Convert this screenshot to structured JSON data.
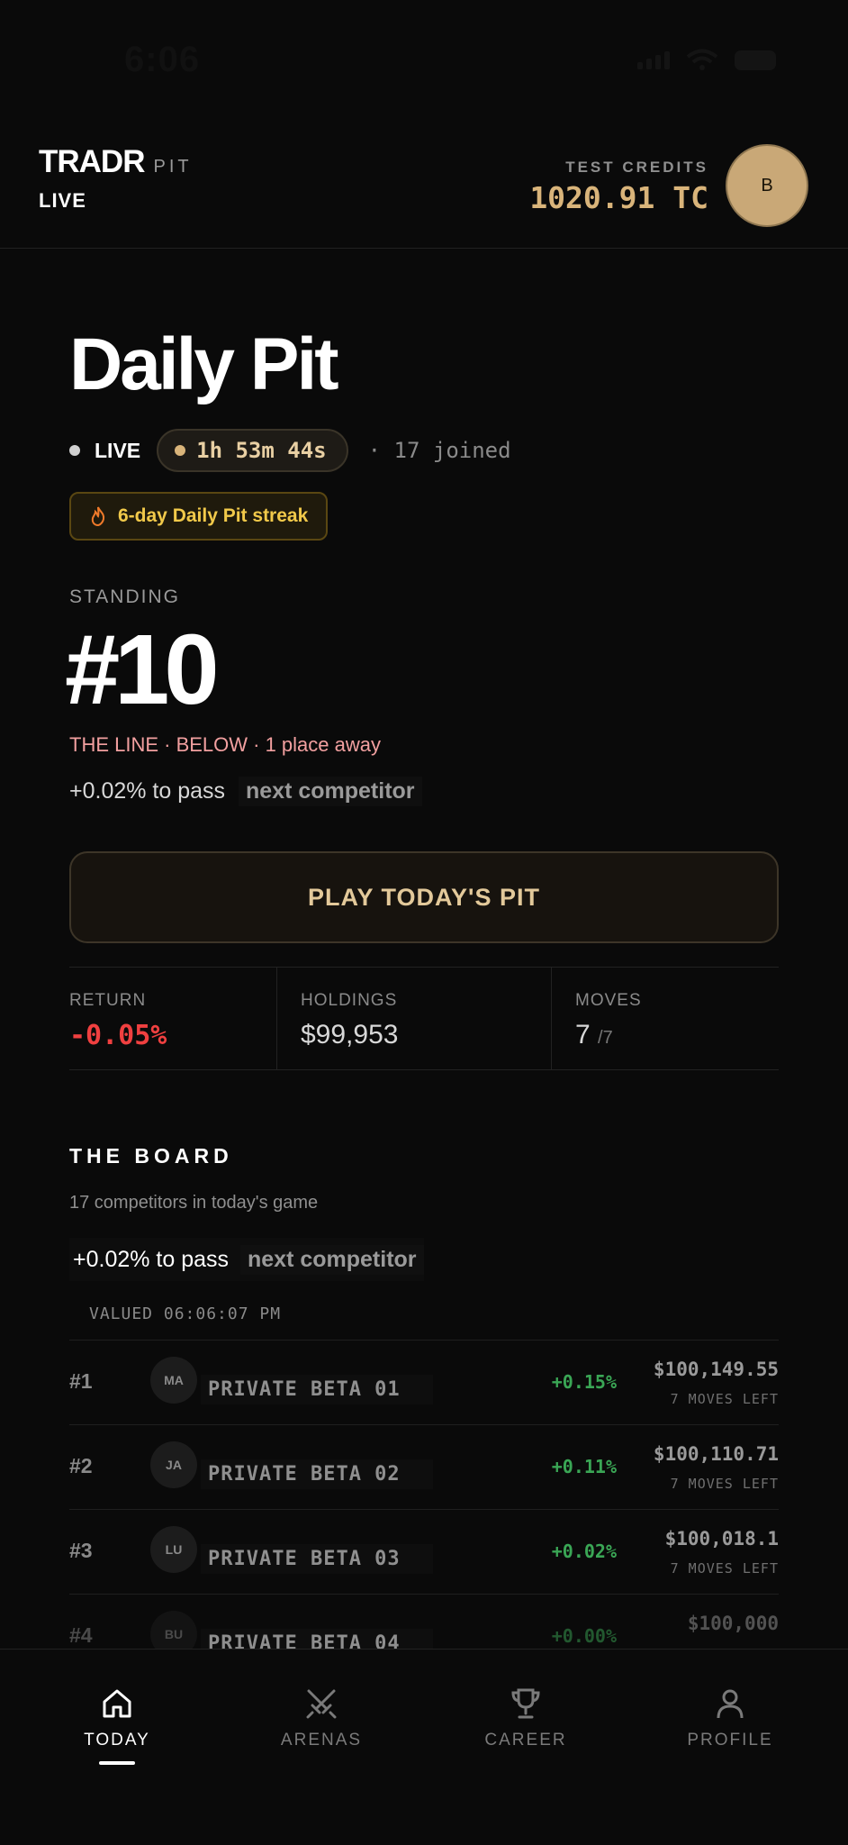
{
  "status_bar": {
    "time": "6:06"
  },
  "header": {
    "brand": "TRADR",
    "brand_sub": "PIT",
    "live": "LIVE",
    "credits_label": "TEST CREDITS",
    "credits_value": "1020.91 TC",
    "avatar_initial": "B"
  },
  "hero": {
    "title": "Daily Pit",
    "live_label": "LIVE",
    "timer": "1h 53m 44s",
    "joined": "· 17 joined",
    "streak": "6-day Daily Pit streak",
    "standing_label": "STANDING",
    "standing_value": "#10",
    "line_status": "THE LINE · BELOW · 1 place away",
    "pass_text": "+0.02% to pass",
    "pass_chip": "next competitor",
    "play_button": "PLAY TODAY'S PIT"
  },
  "stats": {
    "return_label": "RETURN",
    "return_value": "-0.05%",
    "holdings_label": "HOLDINGS",
    "holdings_value": "$99,953",
    "moves_label": "MOVES",
    "moves_value": "7",
    "moves_total": "/7"
  },
  "board": {
    "title": "THE BOARD",
    "subtitle": "17 competitors in today's game",
    "pass_text": "+0.02% to pass",
    "pass_chip": "next competitor",
    "valued": "VALUED 06:06:07 PM",
    "rows": [
      {
        "rank": "#1",
        "initials": "MA",
        "name": "PRIVATE BETA 01",
        "change": "+0.15%",
        "value": "$100,149.55",
        "moves": "7 MOVES LEFT"
      },
      {
        "rank": "#2",
        "initials": "JA",
        "name": "PRIVATE BETA 02",
        "change": "+0.11%",
        "value": "$100,110.71",
        "moves": "7 MOVES LEFT"
      },
      {
        "rank": "#3",
        "initials": "LU",
        "name": "PRIVATE BETA 03",
        "change": "+0.02%",
        "value": "$100,018.1",
        "moves": "7 MOVES LEFT"
      },
      {
        "rank": "#4",
        "initials": "BU",
        "name": "PRIVATE BETA 04",
        "change": "+0.00%",
        "value": "$100,000",
        "moves": ""
      }
    ]
  },
  "tabbar": {
    "tabs": [
      {
        "label": "TODAY",
        "icon": "home-icon"
      },
      {
        "label": "ARENAS",
        "icon": "swords-icon"
      },
      {
        "label": "CAREER",
        "icon": "trophy-icon"
      },
      {
        "label": "PROFILE",
        "icon": "user-icon"
      }
    ]
  },
  "colors": {
    "accent_gold": "#d9b47a",
    "negative": "#f04040",
    "positive": "#3aa655",
    "streak": "#f1c94a"
  }
}
